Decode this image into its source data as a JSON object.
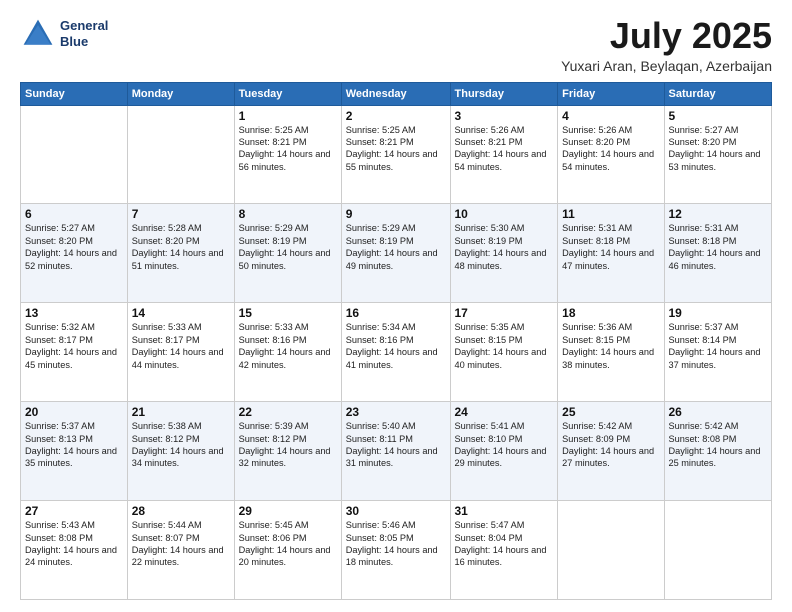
{
  "header": {
    "logo_line1": "General",
    "logo_line2": "Blue",
    "month": "July 2025",
    "location": "Yuxari Aran, Beylaqan, Azerbaijan"
  },
  "days_of_week": [
    "Sunday",
    "Monday",
    "Tuesday",
    "Wednesday",
    "Thursday",
    "Friday",
    "Saturday"
  ],
  "weeks": [
    [
      {
        "day": "",
        "detail": ""
      },
      {
        "day": "",
        "detail": ""
      },
      {
        "day": "1",
        "detail": "Sunrise: 5:25 AM\nSunset: 8:21 PM\nDaylight: 14 hours and 56 minutes."
      },
      {
        "day": "2",
        "detail": "Sunrise: 5:25 AM\nSunset: 8:21 PM\nDaylight: 14 hours and 55 minutes."
      },
      {
        "day": "3",
        "detail": "Sunrise: 5:26 AM\nSunset: 8:21 PM\nDaylight: 14 hours and 54 minutes."
      },
      {
        "day": "4",
        "detail": "Sunrise: 5:26 AM\nSunset: 8:20 PM\nDaylight: 14 hours and 54 minutes."
      },
      {
        "day": "5",
        "detail": "Sunrise: 5:27 AM\nSunset: 8:20 PM\nDaylight: 14 hours and 53 minutes."
      }
    ],
    [
      {
        "day": "6",
        "detail": "Sunrise: 5:27 AM\nSunset: 8:20 PM\nDaylight: 14 hours and 52 minutes."
      },
      {
        "day": "7",
        "detail": "Sunrise: 5:28 AM\nSunset: 8:20 PM\nDaylight: 14 hours and 51 minutes."
      },
      {
        "day": "8",
        "detail": "Sunrise: 5:29 AM\nSunset: 8:19 PM\nDaylight: 14 hours and 50 minutes."
      },
      {
        "day": "9",
        "detail": "Sunrise: 5:29 AM\nSunset: 8:19 PM\nDaylight: 14 hours and 49 minutes."
      },
      {
        "day": "10",
        "detail": "Sunrise: 5:30 AM\nSunset: 8:19 PM\nDaylight: 14 hours and 48 minutes."
      },
      {
        "day": "11",
        "detail": "Sunrise: 5:31 AM\nSunset: 8:18 PM\nDaylight: 14 hours and 47 minutes."
      },
      {
        "day": "12",
        "detail": "Sunrise: 5:31 AM\nSunset: 8:18 PM\nDaylight: 14 hours and 46 minutes."
      }
    ],
    [
      {
        "day": "13",
        "detail": "Sunrise: 5:32 AM\nSunset: 8:17 PM\nDaylight: 14 hours and 45 minutes."
      },
      {
        "day": "14",
        "detail": "Sunrise: 5:33 AM\nSunset: 8:17 PM\nDaylight: 14 hours and 44 minutes."
      },
      {
        "day": "15",
        "detail": "Sunrise: 5:33 AM\nSunset: 8:16 PM\nDaylight: 14 hours and 42 minutes."
      },
      {
        "day": "16",
        "detail": "Sunrise: 5:34 AM\nSunset: 8:16 PM\nDaylight: 14 hours and 41 minutes."
      },
      {
        "day": "17",
        "detail": "Sunrise: 5:35 AM\nSunset: 8:15 PM\nDaylight: 14 hours and 40 minutes."
      },
      {
        "day": "18",
        "detail": "Sunrise: 5:36 AM\nSunset: 8:15 PM\nDaylight: 14 hours and 38 minutes."
      },
      {
        "day": "19",
        "detail": "Sunrise: 5:37 AM\nSunset: 8:14 PM\nDaylight: 14 hours and 37 minutes."
      }
    ],
    [
      {
        "day": "20",
        "detail": "Sunrise: 5:37 AM\nSunset: 8:13 PM\nDaylight: 14 hours and 35 minutes."
      },
      {
        "day": "21",
        "detail": "Sunrise: 5:38 AM\nSunset: 8:12 PM\nDaylight: 14 hours and 34 minutes."
      },
      {
        "day": "22",
        "detail": "Sunrise: 5:39 AM\nSunset: 8:12 PM\nDaylight: 14 hours and 32 minutes."
      },
      {
        "day": "23",
        "detail": "Sunrise: 5:40 AM\nSunset: 8:11 PM\nDaylight: 14 hours and 31 minutes."
      },
      {
        "day": "24",
        "detail": "Sunrise: 5:41 AM\nSunset: 8:10 PM\nDaylight: 14 hours and 29 minutes."
      },
      {
        "day": "25",
        "detail": "Sunrise: 5:42 AM\nSunset: 8:09 PM\nDaylight: 14 hours and 27 minutes."
      },
      {
        "day": "26",
        "detail": "Sunrise: 5:42 AM\nSunset: 8:08 PM\nDaylight: 14 hours and 25 minutes."
      }
    ],
    [
      {
        "day": "27",
        "detail": "Sunrise: 5:43 AM\nSunset: 8:08 PM\nDaylight: 14 hours and 24 minutes."
      },
      {
        "day": "28",
        "detail": "Sunrise: 5:44 AM\nSunset: 8:07 PM\nDaylight: 14 hours and 22 minutes."
      },
      {
        "day": "29",
        "detail": "Sunrise: 5:45 AM\nSunset: 8:06 PM\nDaylight: 14 hours and 20 minutes."
      },
      {
        "day": "30",
        "detail": "Sunrise: 5:46 AM\nSunset: 8:05 PM\nDaylight: 14 hours and 18 minutes."
      },
      {
        "day": "31",
        "detail": "Sunrise: 5:47 AM\nSunset: 8:04 PM\nDaylight: 14 hours and 16 minutes."
      },
      {
        "day": "",
        "detail": ""
      },
      {
        "day": "",
        "detail": ""
      }
    ]
  ]
}
